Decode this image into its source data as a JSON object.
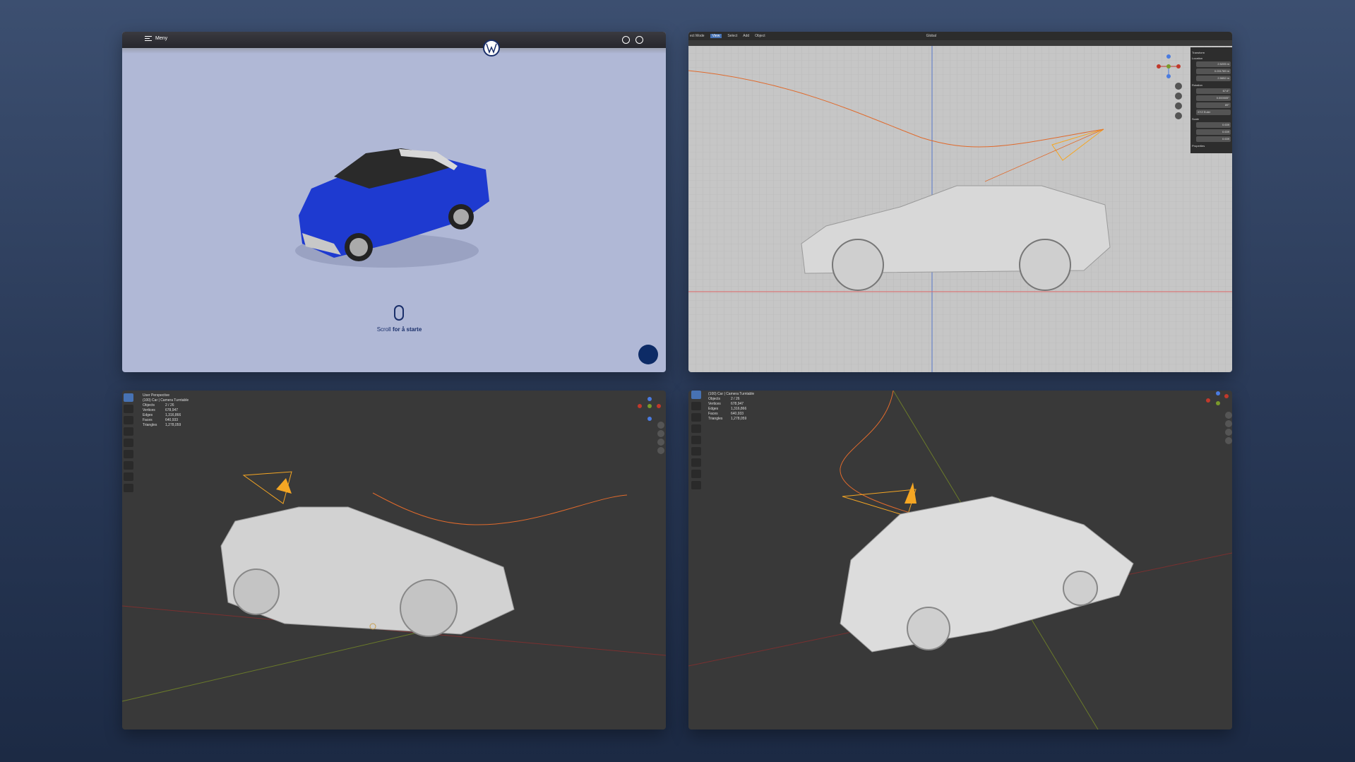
{
  "vw": {
    "menu_label": "Meny",
    "scroll_prefix": "Scroll",
    "scroll_suffix": "for å starte",
    "brand_color": "#0d2b66",
    "car_color": "#1e3ad0"
  },
  "blender_top": {
    "menu": [
      "ect Mode",
      "View",
      "Select",
      "Add",
      "Object"
    ],
    "transform_orientation": "Global",
    "n_panel": {
      "title": "Transform",
      "location_label": "Location",
      "location": [
        "2.5205 m",
        "0.031789 m",
        "2.5652 m"
      ],
      "rotation_label": "Rotation",
      "rotation": [
        "67.6°",
        "0.000005°",
        "89°"
      ],
      "rotation_mode": "XYZ Euler",
      "scale_label": "Scale",
      "scale": [
        "0.639",
        "0.639",
        "0.639"
      ],
      "properties_label": "Properties"
    }
  },
  "blender_left": {
    "view_label": "User Perspective",
    "collection": "(100) Car | Camera Turntable",
    "stats": [
      {
        "k": "Objects",
        "v": "2 / 26"
      },
      {
        "k": "Vertices",
        "v": "678,947"
      },
      {
        "k": "Edges",
        "v": "1,316,866"
      },
      {
        "k": "Faces",
        "v": "640,933"
      },
      {
        "k": "Triangles",
        "v": "1,278,059"
      }
    ]
  },
  "blender_right": {
    "collection": "(100) Car | Camera Turntable",
    "stats": [
      {
        "k": "Objects",
        "v": "2 / 26"
      },
      {
        "k": "Vertices",
        "v": "678,947"
      },
      {
        "k": "Edges",
        "v": "1,316,866"
      },
      {
        "k": "Faces",
        "v": "640,933"
      },
      {
        "k": "Triangles",
        "v": "1,278,059"
      }
    ]
  },
  "colors": {
    "camera": "#f5a623",
    "path": "#e06a2c",
    "axis_x": "#c0392b",
    "axis_y": "#7a9a2a",
    "select_blue": "#4772b3"
  }
}
